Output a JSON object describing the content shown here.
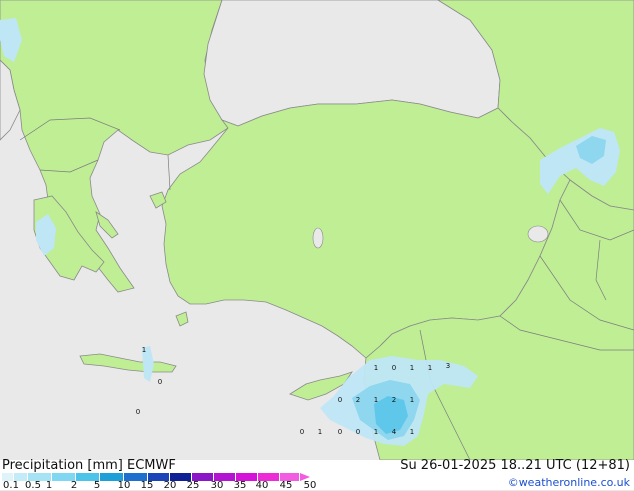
{
  "map": {
    "region": "Eastern Mediterranean / Turkey",
    "colors": {
      "sea": "#e9e9e9",
      "land": "#bfee95",
      "coast": "#8a8a8a",
      "border": "#7c7c7c",
      "precip_light": "#bfe6f5",
      "precip_mid": "#8fd6ef",
      "precip_heavy": "#5ec7ea"
    },
    "point_values": [
      "1",
      "0",
      "1",
      "1",
      "3",
      "0",
      "2",
      "1",
      "2",
      "1",
      "0",
      "1",
      "0",
      "0",
      "1",
      "4",
      "1",
      "1",
      "0",
      "0"
    ]
  },
  "legend": {
    "title": "Precipitation [mm]",
    "model": "ECMWF",
    "validity": "Su 26-01-2025 18..21 UTC (12+81)",
    "credit": "©weatheronline.co.uk",
    "scale_labels": [
      "0.1",
      "0.5",
      "1",
      "2",
      "5",
      "10",
      "15",
      "20",
      "25",
      "30",
      "35",
      "40",
      "45",
      "50"
    ],
    "scale_colors": [
      "#dff3fb",
      "#c4ecf8",
      "#a6e3f5",
      "#7fd7f1",
      "#4cc4ea",
      "#1f9fd8",
      "#1f6fcf",
      "#1a44b8",
      "#0f1f96",
      "#8a16c8",
      "#b314d2",
      "#d412d8",
      "#ec2ad6",
      "#f25ce0"
    ]
  }
}
